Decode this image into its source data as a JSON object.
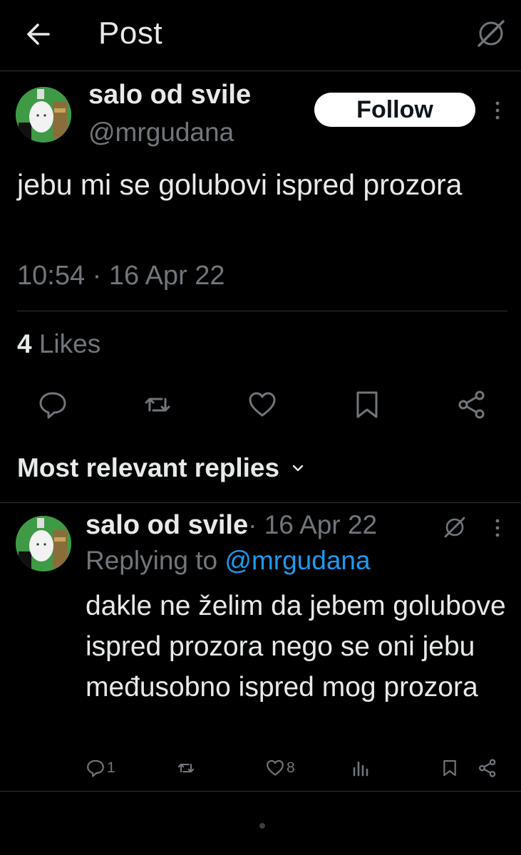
{
  "header": {
    "title": "Post",
    "back_icon": "arrow-left-icon",
    "grok_icon": "grok-icon"
  },
  "post": {
    "author": {
      "display_name": "salo od svile",
      "handle": "@mrgudana"
    },
    "follow_label": "Follow",
    "text": "jebu mi se golubovi ispred prozora",
    "timestamp": "10:54 · 16 Apr 22",
    "likes_count": "4",
    "likes_label": " Likes",
    "actions": [
      "reply-icon",
      "repost-icon",
      "like-icon",
      "bookmark-icon",
      "share-icon"
    ]
  },
  "replies_filter": {
    "label": "Most relevant replies"
  },
  "reply": {
    "author": {
      "display_name": "salo od svile"
    },
    "meta": " · 16 Apr 22",
    "replying_prefix": "Replying to ",
    "replying_mention": "@mrgudana",
    "text": "dakle ne želim da jebem golubove ispred prozora nego se oni jebu međusobno ispred mog prozora",
    "reply_count": "1",
    "like_count": "8"
  },
  "colors": {
    "background": "#000000",
    "text": "#e7e9ea",
    "secondary": "#71767b",
    "link": "#1d9bf0",
    "avatar_green": "#3f9a45"
  }
}
